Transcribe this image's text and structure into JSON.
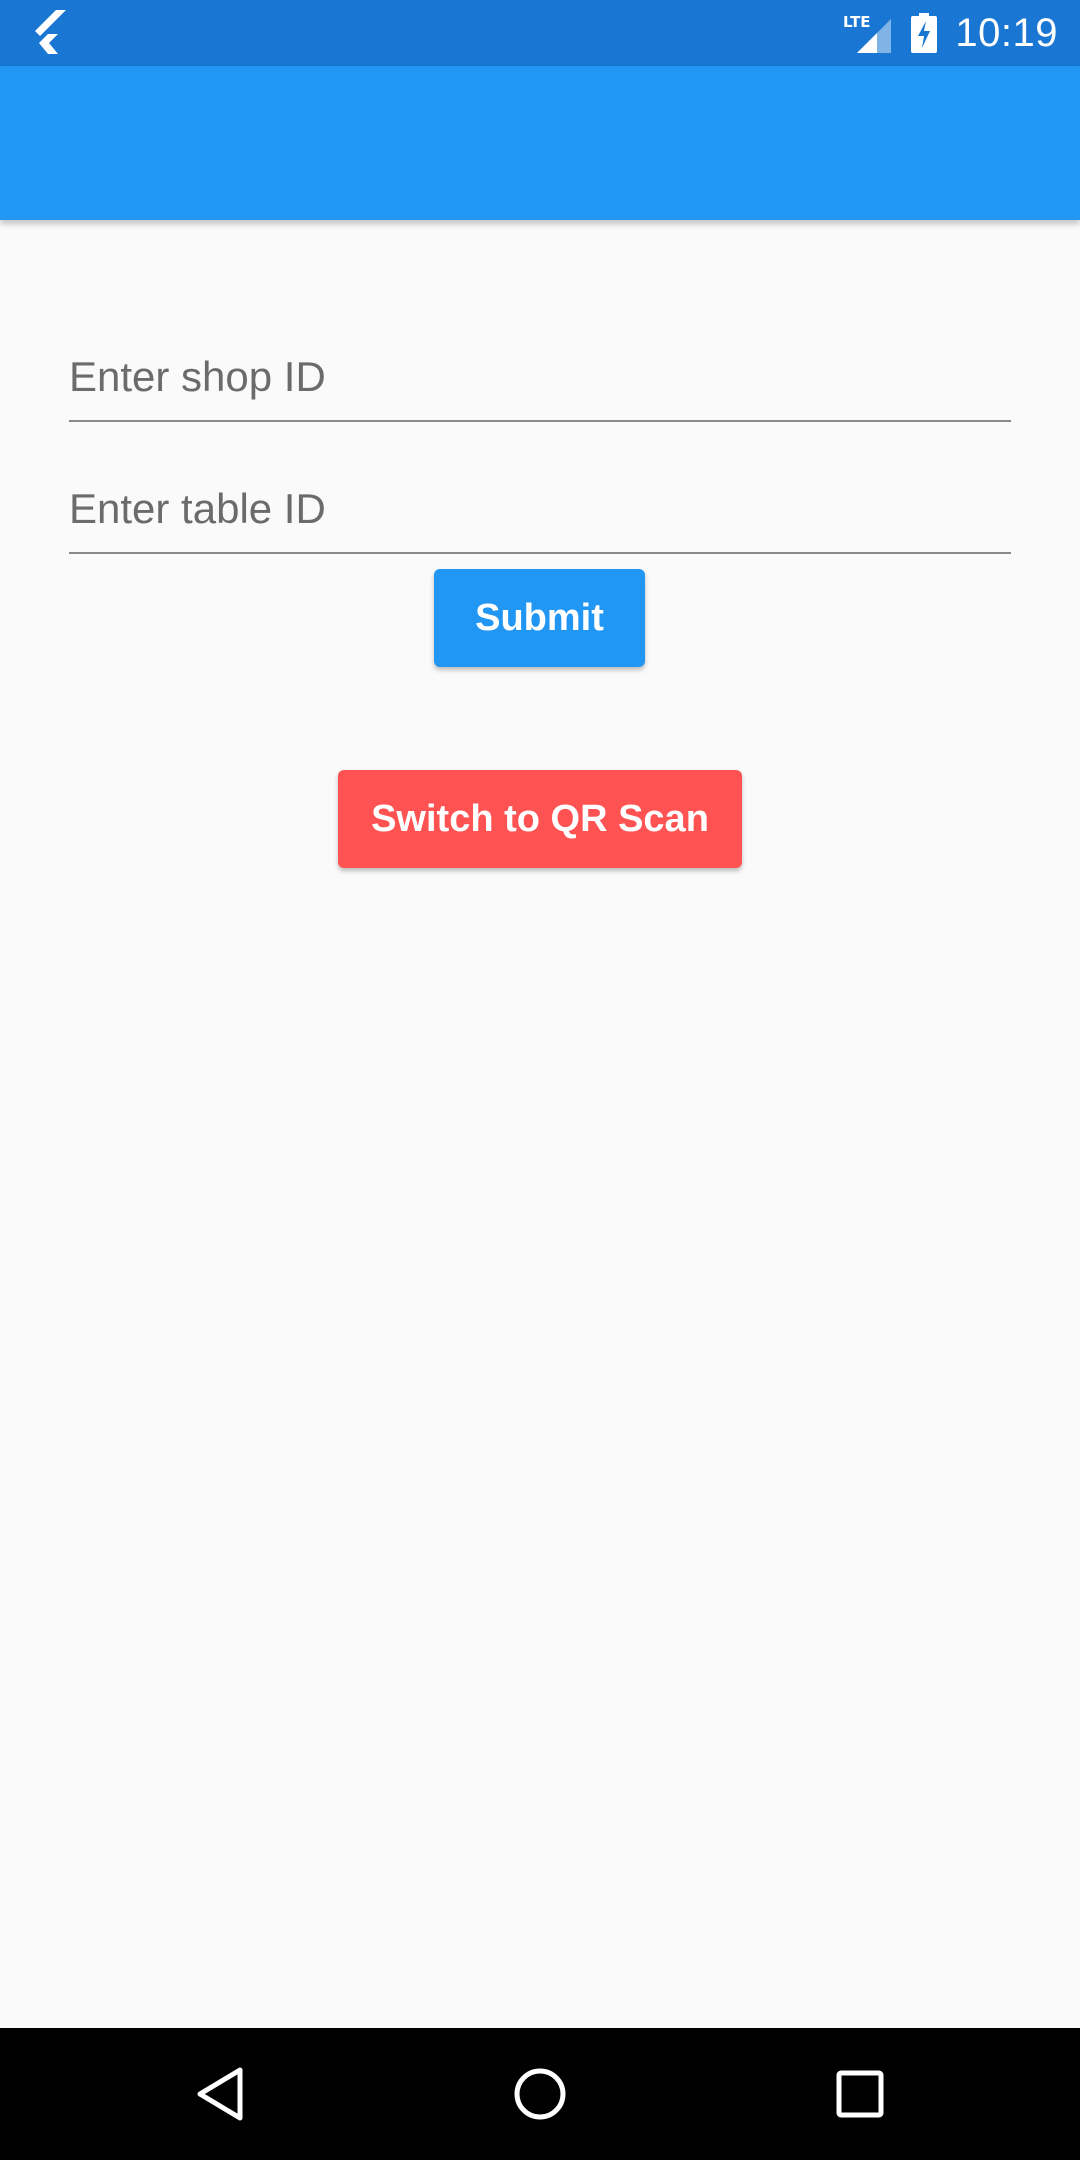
{
  "status_bar": {
    "network_label": "LTE",
    "time": "10:19"
  },
  "icons": {
    "app": "flutter-logo-icon",
    "signal": "lte-signal-icon",
    "battery": "battery-charging-icon",
    "back": "back-triangle-icon",
    "home": "home-circle-icon",
    "recent": "recent-apps-square-icon"
  },
  "form": {
    "shop_id_placeholder": "Enter shop ID",
    "table_id_placeholder": "Enter table ID",
    "submit_label": "Submit",
    "qr_label": "Switch to QR Scan"
  },
  "colors": {
    "status_bar": "#1976d2",
    "app_bar": "#2196f3",
    "submit_button": "#2196f3",
    "qr_button": "#ff5252",
    "background": "#fafafa",
    "nav_bar": "#000000"
  }
}
